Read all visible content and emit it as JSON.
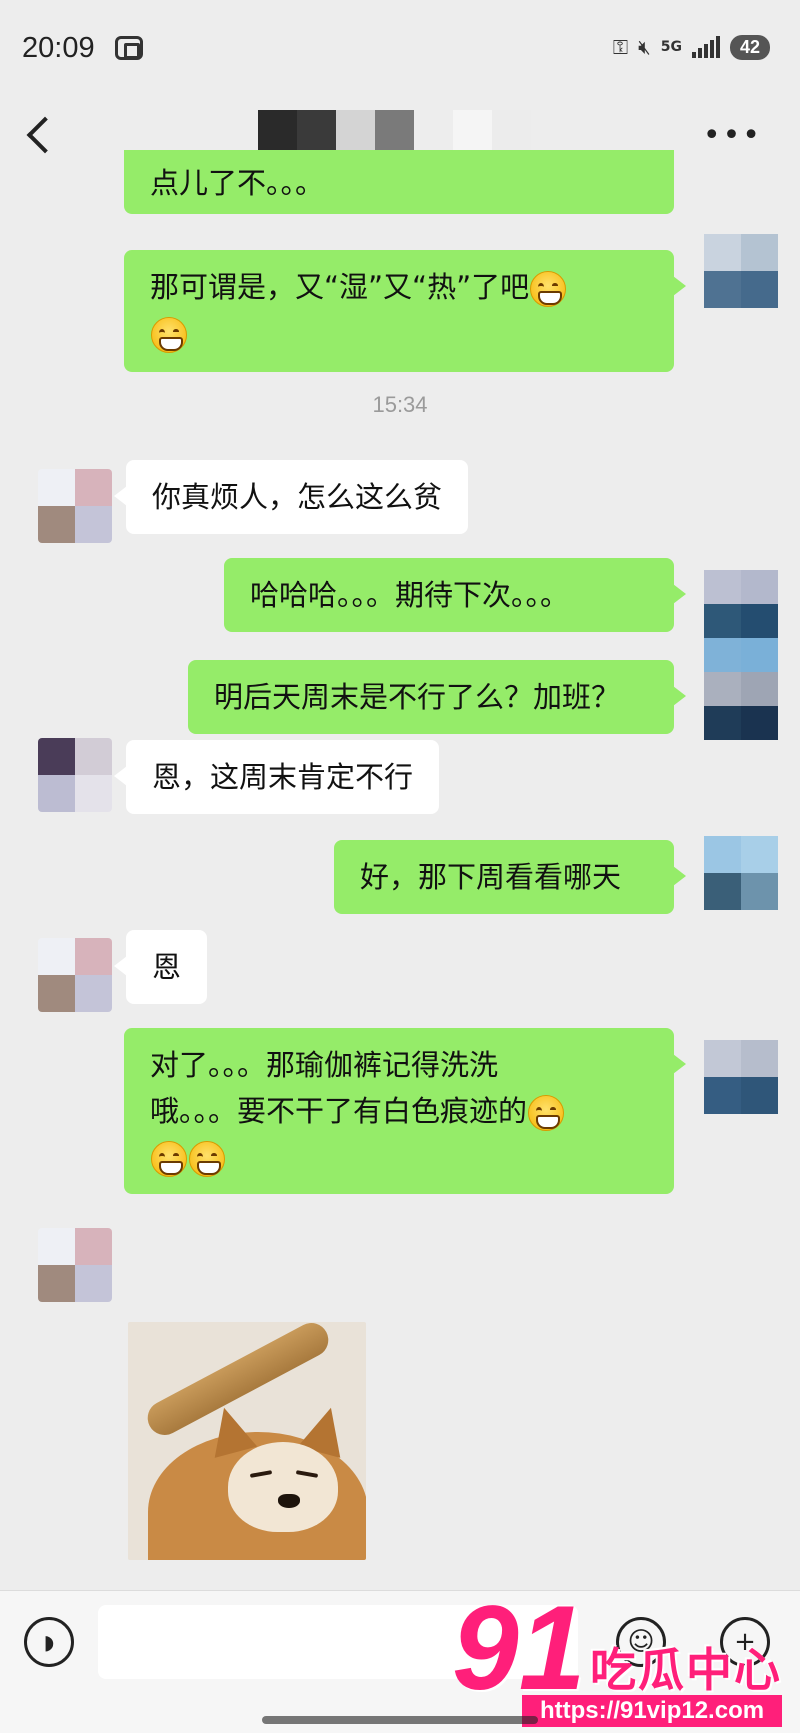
{
  "status_bar": {
    "time": "20:09",
    "network": "5G",
    "battery": "42"
  },
  "header": {
    "title_obscured": true
  },
  "messages": [
    {
      "side": "right",
      "text": "点儿了不。。。"
    },
    {
      "side": "right",
      "text": "那可谓是，又“湿”又“热”了吧",
      "emoji_trailing": 2
    },
    {
      "type": "timestamp",
      "text": "15:34"
    },
    {
      "side": "left",
      "text": "你真烦人，怎么这么贫"
    },
    {
      "side": "right",
      "text": "哈哈哈。。。期待下次。。。"
    },
    {
      "side": "right",
      "text": "明后天周末是不行了么？加班？"
    },
    {
      "side": "left",
      "text": "恩，这周末肯定不行"
    },
    {
      "side": "right",
      "text": "好，那下周看看哪天"
    },
    {
      "side": "left",
      "text": "恩"
    },
    {
      "side": "right",
      "line1": "对了。。。那瑜伽裤记得洗洗",
      "line2": "哦。。。要不干了有白色痕迹的",
      "emoji_trailing": 3
    },
    {
      "side": "left",
      "type": "sticker",
      "sticker": "shiba-dog-bonk-sticker"
    }
  ],
  "input_bar": {
    "voice_icon": "voice-icon",
    "emoji_icon": "emoji-icon",
    "plus_icon": "plus-icon"
  },
  "watermark": {
    "number": "91",
    "brand": "吃瓜中心",
    "url": "https://91vip12.com"
  },
  "colors": {
    "background": "#ededed",
    "right_bubble": "#95ec69",
    "left_bubble": "#ffffff",
    "watermark": "#ff1f7a"
  }
}
